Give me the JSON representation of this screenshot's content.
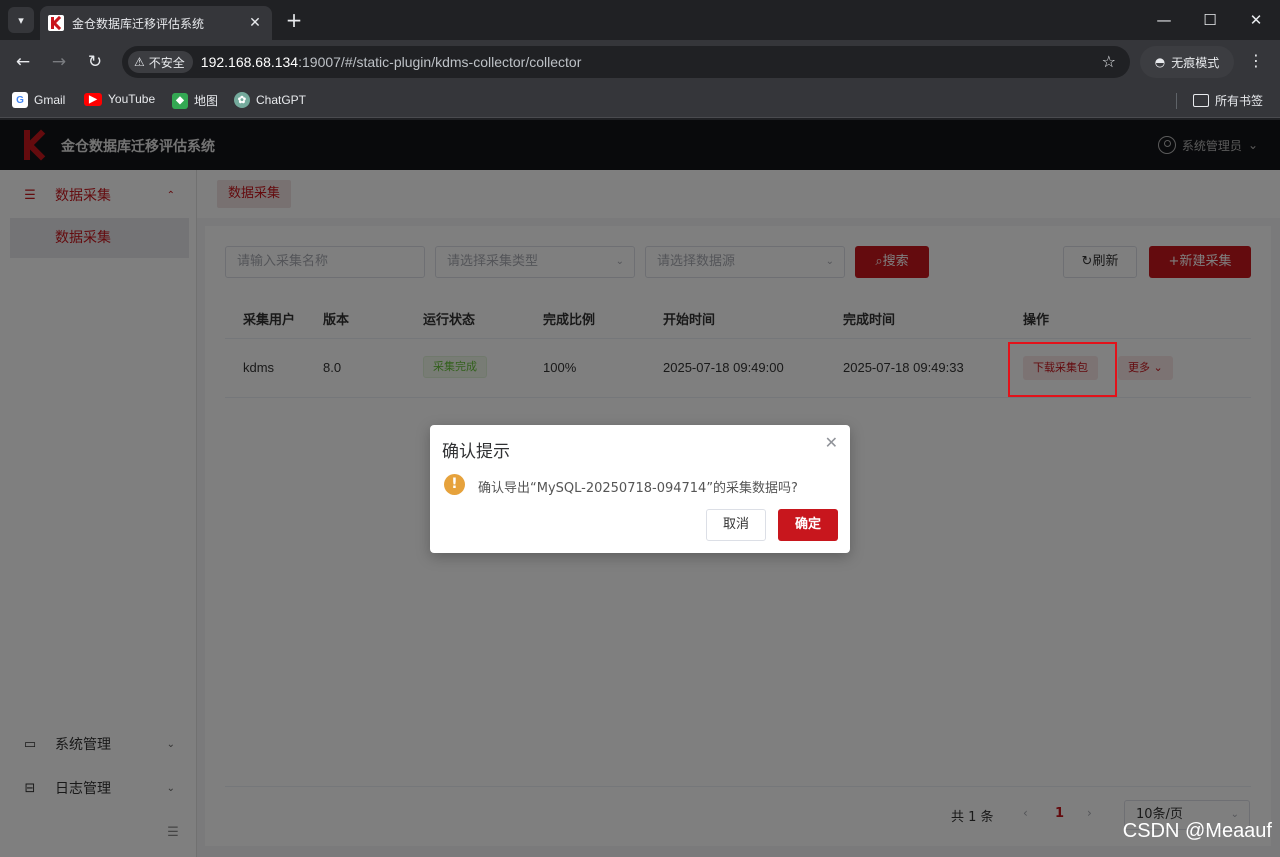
{
  "browser": {
    "tab_title": "金仓数据库迁移评估系统",
    "security_label": "不安全",
    "url_host": "192.168.68.134",
    "url_path": ":19007/#/static-plugin/kdms-collector/collector",
    "incognito_label": "无痕模式",
    "bookmarks": [
      "Gmail",
      "YouTube",
      "地图",
      "ChatGPT"
    ],
    "all_bookmarks": "所有书签"
  },
  "app": {
    "title": "金仓数据库迁移评估系统",
    "user": "系统管理员"
  },
  "sidebar": {
    "items": [
      {
        "label": "数据采集",
        "icon": "list-check-icon"
      },
      {
        "label": "数据采集"
      },
      {
        "label": "系统管理",
        "icon": "monitor-icon"
      },
      {
        "label": "日志管理",
        "icon": "archive-icon"
      }
    ]
  },
  "breadcrumb": "数据采集",
  "filters": {
    "name_placeholder": "请输入采集名称",
    "type_placeholder": "请选择采集类型",
    "source_placeholder": "请选择数据源",
    "search": "搜索",
    "refresh": "刷新",
    "new": "+新建采集"
  },
  "table": {
    "headers": [
      "采集用户",
      "版本",
      "运行状态",
      "完成比例",
      "开始时间",
      "完成时间",
      "操作"
    ],
    "rows": [
      {
        "user": "kdms",
        "version": "8.0",
        "status": "采集完成",
        "progress": "100%",
        "start": "2025-07-18 09:49:00",
        "end": "2025-07-18 09:49:33",
        "download": "下载采集包",
        "more": "更多"
      }
    ]
  },
  "pager": {
    "total": "共 1 条",
    "current": "1",
    "page_size": "10条/页"
  },
  "dialog": {
    "title": "确认提示",
    "message": "确认导出“MySQL-20250718-094714”的采集数据吗?",
    "cancel": "取消",
    "confirm": "确定"
  },
  "watermark": "CSDN @Meaauf"
}
